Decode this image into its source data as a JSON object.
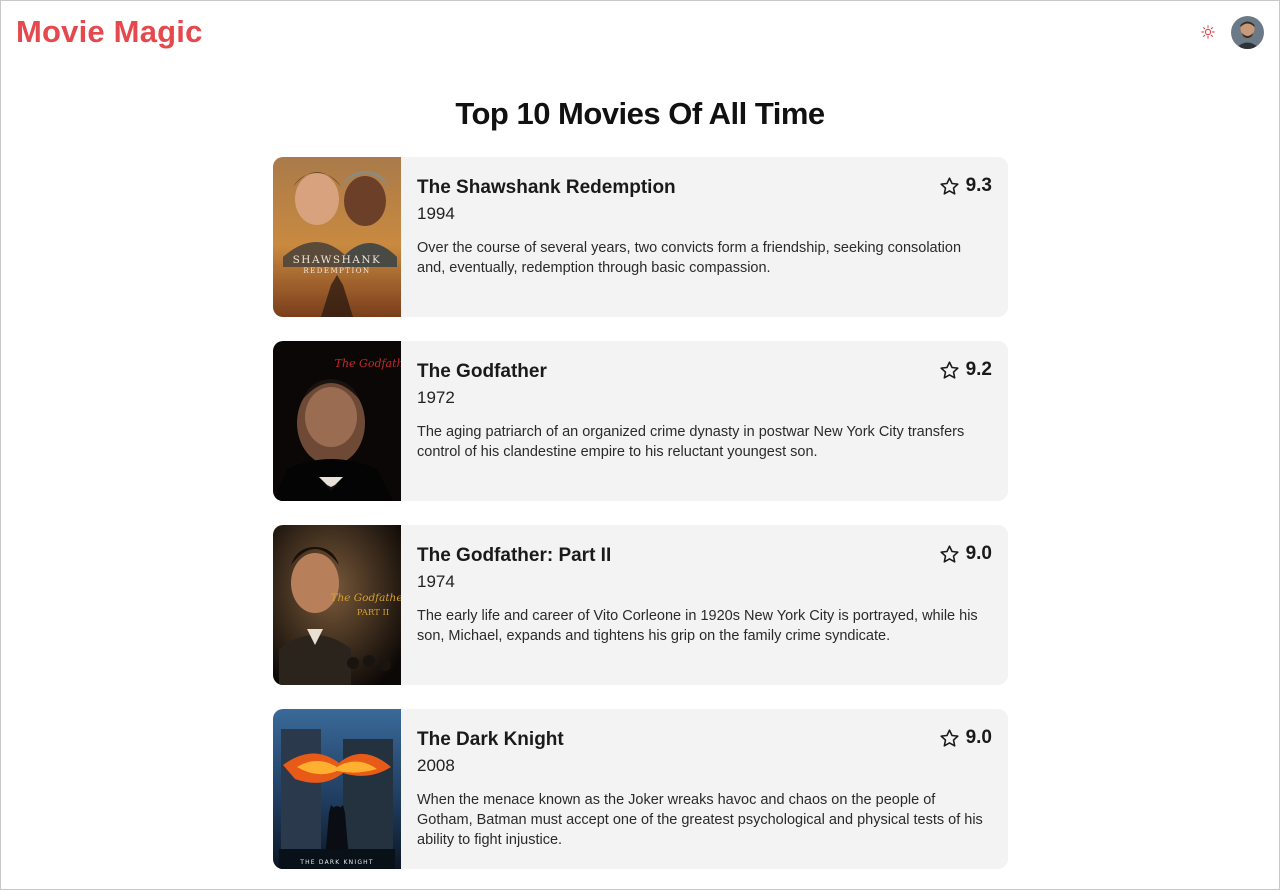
{
  "header": {
    "brand": "Movie Magic",
    "theme_icon": "sun-icon",
    "avatar_icon": "user-avatar"
  },
  "page": {
    "title": "Top 10 Movies Of All Time"
  },
  "colors": {
    "brand": "#e5484d",
    "card_bg": "#f3f3f3",
    "text": "#1a1a1a"
  },
  "movies": [
    {
      "title": "The Shawshank Redemption",
      "year": "1994",
      "rating": "9.3",
      "description": "Over the course of several years, two convicts form a friendship, seeking consolation and, eventually, redemption through basic compassion.",
      "poster_text": "SHAWSHANK",
      "poster_subtext": "REDEMPTION"
    },
    {
      "title": "The Godfather",
      "year": "1972",
      "rating": "9.2",
      "description": "The aging patriarch of an organized crime dynasty in postwar New York City transfers control of his clandestine empire to his reluctant youngest son.",
      "poster_text": "The Godfather"
    },
    {
      "title": "The Godfather: Part II",
      "year": "1974",
      "rating": "9.0",
      "description": "The early life and career of Vito Corleone in 1920s New York City is portrayed, while his son, Michael, expands and tightens his grip on the family crime syndicate.",
      "poster_text": "The Godfather",
      "poster_subtext": "PART II"
    },
    {
      "title": "The Dark Knight",
      "year": "2008",
      "rating": "9.0",
      "description": "When the menace known as the Joker wreaks havoc and chaos on the people of Gotham, Batman must accept one of the greatest psychological and physical tests of his ability to fight injustice.",
      "poster_text": "THE DARK KNIGHT"
    }
  ]
}
